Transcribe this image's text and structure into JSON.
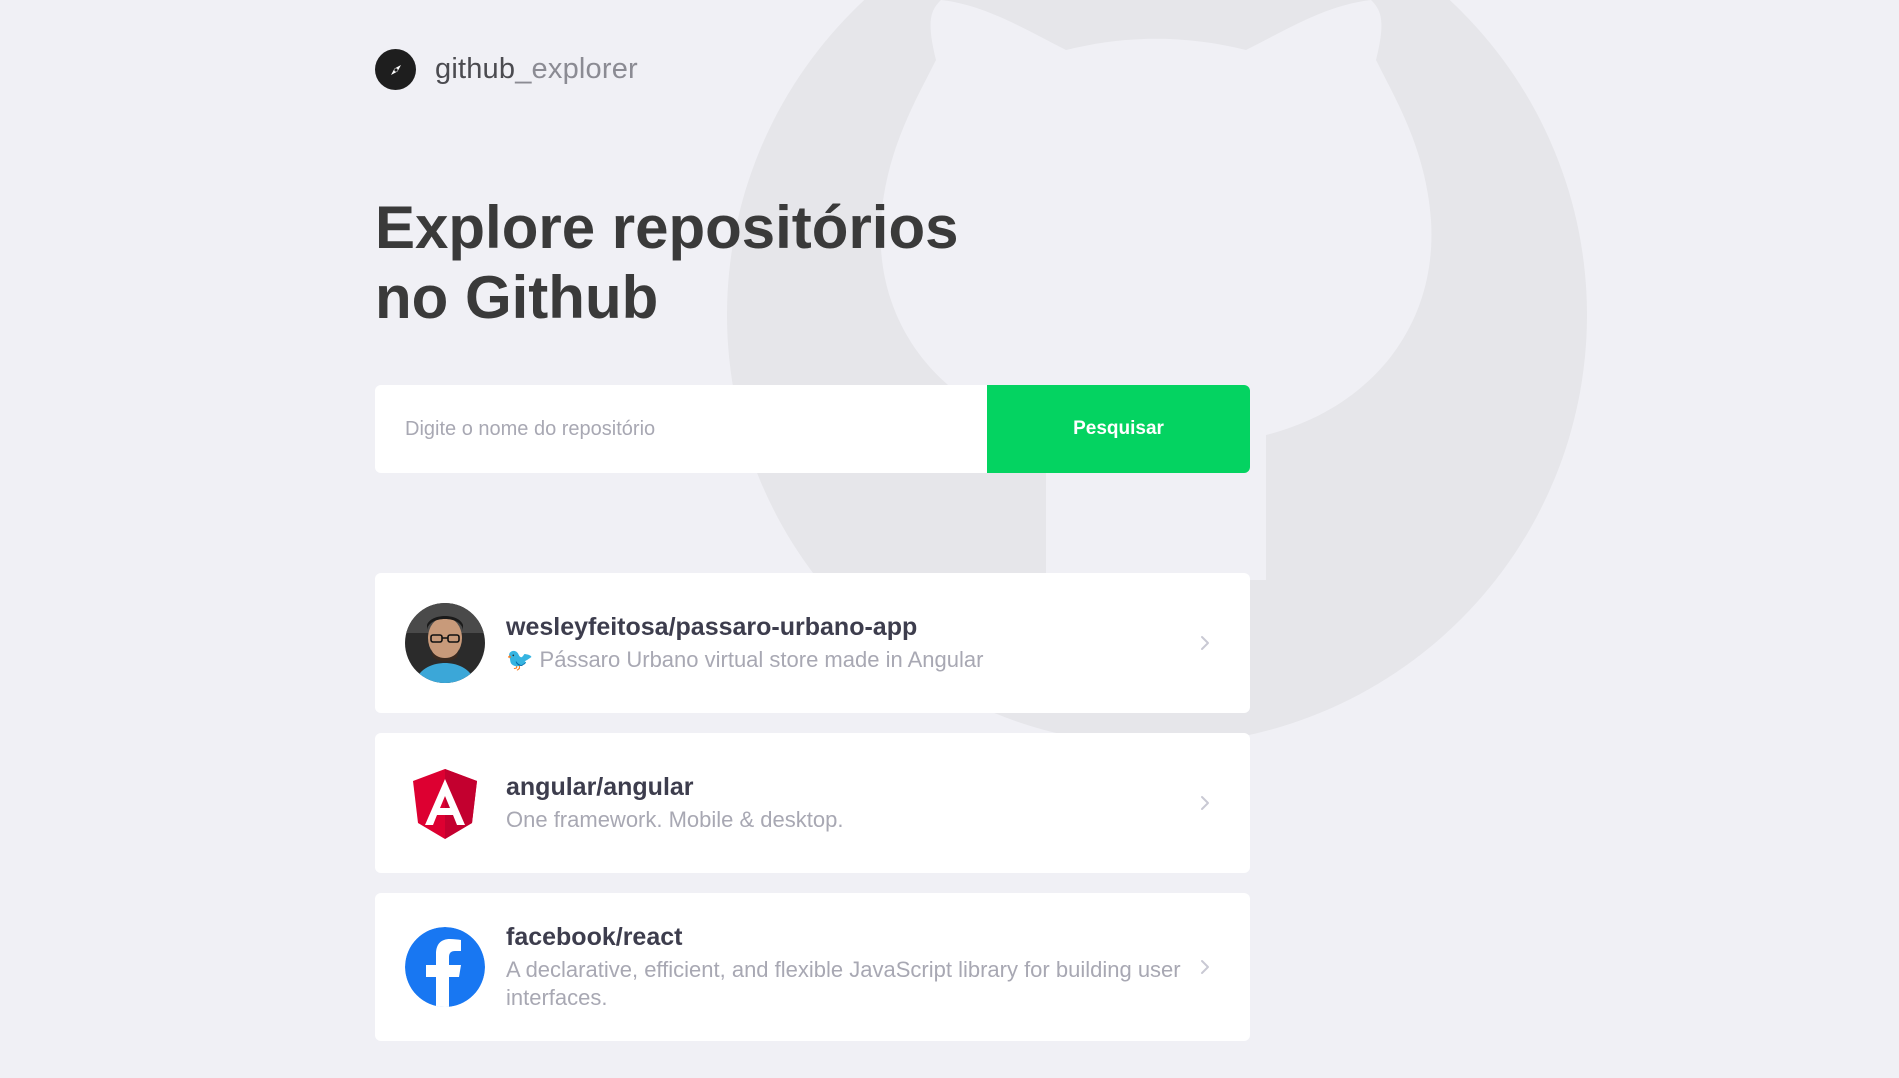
{
  "brand": {
    "name_part1": "github",
    "name_part2": "_explorer"
  },
  "title": {
    "line1": "Explore repositórios",
    "line2": "no Github"
  },
  "search": {
    "placeholder": "Digite o nome do repositório",
    "value": "",
    "button_label": "Pesquisar"
  },
  "colors": {
    "background": "#f0f0f5",
    "accent": "#04d361",
    "title": "#3a3a3a",
    "muted": "#a8a8b3"
  },
  "repositories": [
    {
      "full_name": "wesleyfeitosa/passaro-urbano-app",
      "description_emoji": "🐦",
      "description": "Pássaro Urbano virtual store made in Angular",
      "avatar_icon": "user-photo-avatar"
    },
    {
      "full_name": "angular/angular",
      "description": "One framework. Mobile & desktop.",
      "avatar_icon": "angular-logo-icon"
    },
    {
      "full_name": "facebook/react",
      "description": "A declarative, efficient, and flexible JavaScript library for building user interfaces.",
      "avatar_icon": "facebook-logo-icon"
    }
  ]
}
